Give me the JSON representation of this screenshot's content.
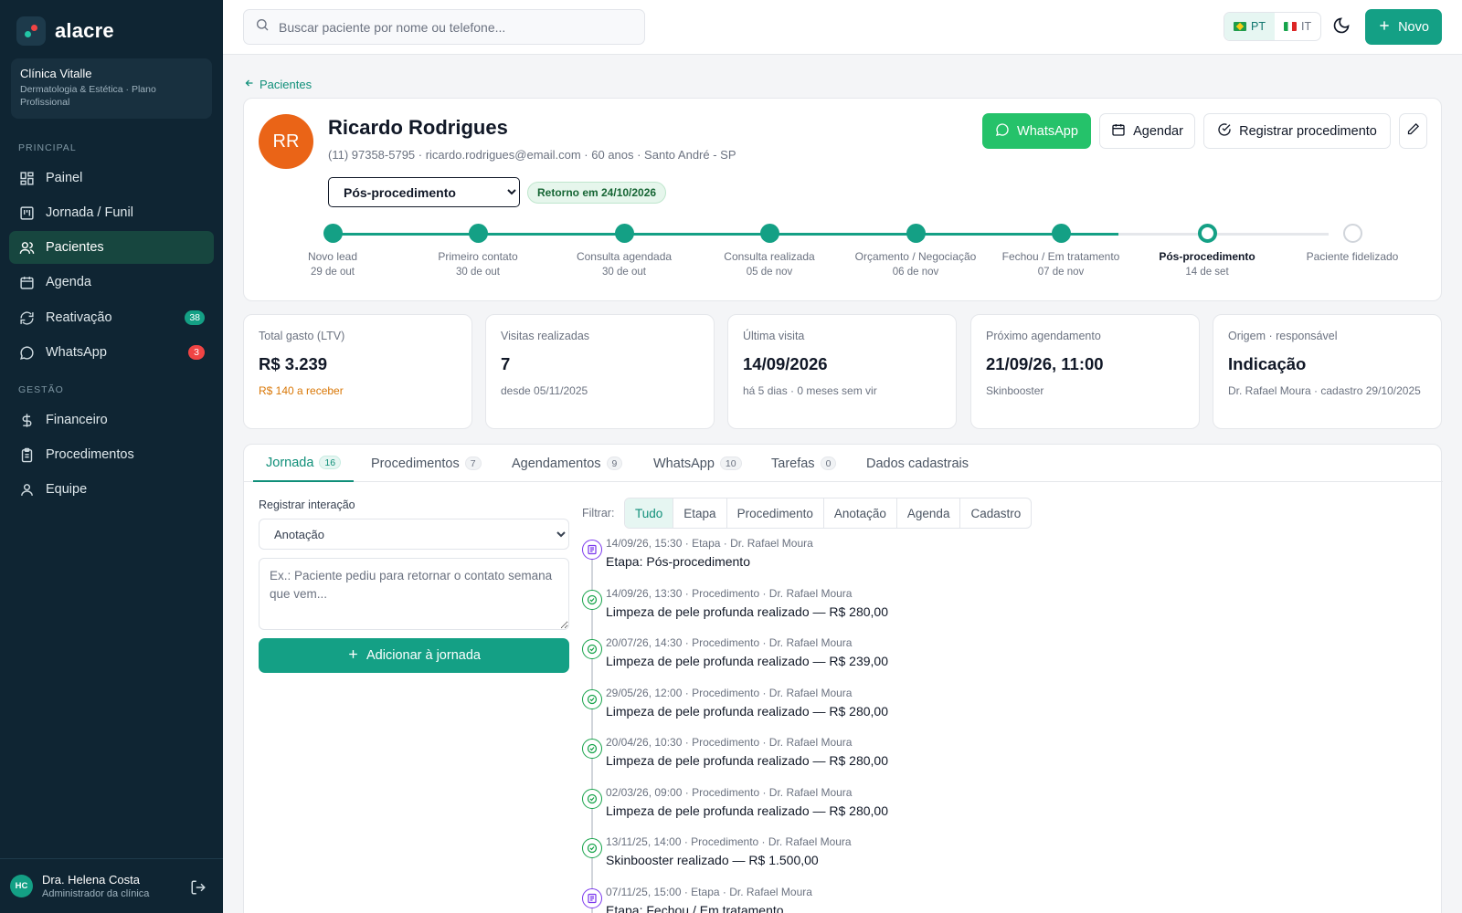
{
  "brand": {
    "name": "alacre"
  },
  "clinic": {
    "name": "Clínica Vitalle",
    "subtitle": "Dermatologia & Estética · Plano Profissional"
  },
  "sidebar": {
    "section_principal": "PRINCIPAL",
    "section_gestao": "GESTÃO",
    "items": [
      {
        "label": "Painel",
        "icon": "dashboard-icon"
      },
      {
        "label": "Jornada / Funil",
        "icon": "funnel-board-icon"
      },
      {
        "label": "Pacientes",
        "icon": "users-icon",
        "active": true
      },
      {
        "label": "Agenda",
        "icon": "calendar-icon"
      },
      {
        "label": "Reativação",
        "icon": "refresh-icon",
        "badge": "38"
      },
      {
        "label": "WhatsApp",
        "icon": "chat-bubble-icon",
        "badge": "3"
      },
      {
        "label": "Financeiro",
        "icon": "dollar-icon"
      },
      {
        "label": "Procedimentos",
        "icon": "clipboard-icon"
      },
      {
        "label": "Equipe",
        "icon": "user-icon"
      }
    ]
  },
  "user": {
    "initials": "HC",
    "name": "Dra. Helena Costa",
    "role": "Administrador da clínica"
  },
  "topbar": {
    "search_placeholder": "Buscar paciente por nome ou telefone...",
    "lang_pt": "PT",
    "lang_it": "IT",
    "new_label": "Novo"
  },
  "breadcrumb": {
    "back_label": "Pacientes"
  },
  "patient": {
    "initials": "RR",
    "name": "Ricardo Rodrigues",
    "meta": "(11) 97358-5795 · ricardo.rodrigues@email.com · 60 anos · Santo André - SP",
    "stage_selected": "Pós-procedimento",
    "return_badge": "Retorno em 24/10/2026"
  },
  "actions": {
    "whatsapp": "WhatsApp",
    "schedule": "Agendar",
    "register": "Registrar procedimento"
  },
  "stepper": [
    {
      "label": "Novo lead",
      "date": "29 de out",
      "state": "done"
    },
    {
      "label": "Primeiro contato",
      "date": "30 de out",
      "state": "done"
    },
    {
      "label": "Consulta agendada",
      "date": "30 de out",
      "state": "done"
    },
    {
      "label": "Consulta realizada",
      "date": "05 de nov",
      "state": "done"
    },
    {
      "label": "Orçamento / Negociação",
      "date": "06 de nov",
      "state": "done"
    },
    {
      "label": "Fechou / Em tratamento",
      "date": "07 de nov",
      "state": "done"
    },
    {
      "label": "Pós-procedimento",
      "date": "14 de set",
      "state": "current"
    },
    {
      "label": "Paciente fidelizado",
      "date": "",
      "state": "todo"
    }
  ],
  "kpis": [
    {
      "label": "Total gasto (LTV)",
      "value": "R$ 3.239",
      "sub": "R$ 140 a receber",
      "warn": true
    },
    {
      "label": "Visitas realizadas",
      "value": "7",
      "sub": "desde 05/11/2025"
    },
    {
      "label": "Última visita",
      "value": "14/09/2026",
      "sub": "há 5 dias · 0 meses sem vir"
    },
    {
      "label": "Próximo agendamento",
      "value": "21/09/26, 11:00",
      "sub": "Skinbooster"
    },
    {
      "label": "Origem · responsável",
      "value": "Indicação",
      "sub": "Dr. Rafael Moura · cadastro 29/10/2025"
    }
  ],
  "tabs": [
    {
      "label": "Jornada",
      "count": "16",
      "active": true
    },
    {
      "label": "Procedimentos",
      "count": "7"
    },
    {
      "label": "Agendamentos",
      "count": "9"
    },
    {
      "label": "WhatsApp",
      "count": "10"
    },
    {
      "label": "Tarefas",
      "count": "0"
    },
    {
      "label": "Dados cadastrais",
      "count": ""
    }
  ],
  "interaction_form": {
    "label": "Registrar interação",
    "type_selected": "Anotação",
    "note_placeholder": "Ex.: Paciente pediu para retornar o contato semana que vem...",
    "submit": "Adicionar à jornada"
  },
  "filters": {
    "label": "Filtrar:",
    "options": [
      "Tudo",
      "Etapa",
      "Procedimento",
      "Anotação",
      "Agenda",
      "Cadastro"
    ],
    "active": "Tudo"
  },
  "timeline": [
    {
      "kind": "stage",
      "meta": "14/09/26, 15:30 · Etapa · Dr. Rafael Moura",
      "text": "Etapa: Pós-procedimento"
    },
    {
      "kind": "proc",
      "meta": "14/09/26, 13:30 · Procedimento · Dr. Rafael Moura",
      "text": "Limpeza de pele profunda realizado — R$ 280,00"
    },
    {
      "kind": "proc",
      "meta": "20/07/26, 14:30 · Procedimento · Dr. Rafael Moura",
      "text": "Limpeza de pele profunda realizado — R$ 239,00"
    },
    {
      "kind": "proc",
      "meta": "29/05/26, 12:00 · Procedimento · Dr. Rafael Moura",
      "text": "Limpeza de pele profunda realizado — R$ 280,00"
    },
    {
      "kind": "proc",
      "meta": "20/04/26, 10:30 · Procedimento · Dr. Rafael Moura",
      "text": "Limpeza de pele profunda realizado — R$ 280,00"
    },
    {
      "kind": "proc",
      "meta": "02/03/26, 09:00 · Procedimento · Dr. Rafael Moura",
      "text": "Limpeza de pele profunda realizado — R$ 280,00"
    },
    {
      "kind": "proc",
      "meta": "13/11/25, 14:00 · Procedimento · Dr. Rafael Moura",
      "text": "Skinbooster realizado — R$ 1.500,00"
    },
    {
      "kind": "stage",
      "meta": "07/11/25, 15:00 · Etapa · Dr. Rafael Moura",
      "text": "Etapa: Fechou / Em tratamento"
    }
  ],
  "colors": {
    "accent": "#14a085",
    "sidebar": "#0f2533",
    "whatsapp": "#25c26a",
    "avatar": "#ea6417",
    "warn": "#d97706",
    "danger": "#ef4444"
  }
}
